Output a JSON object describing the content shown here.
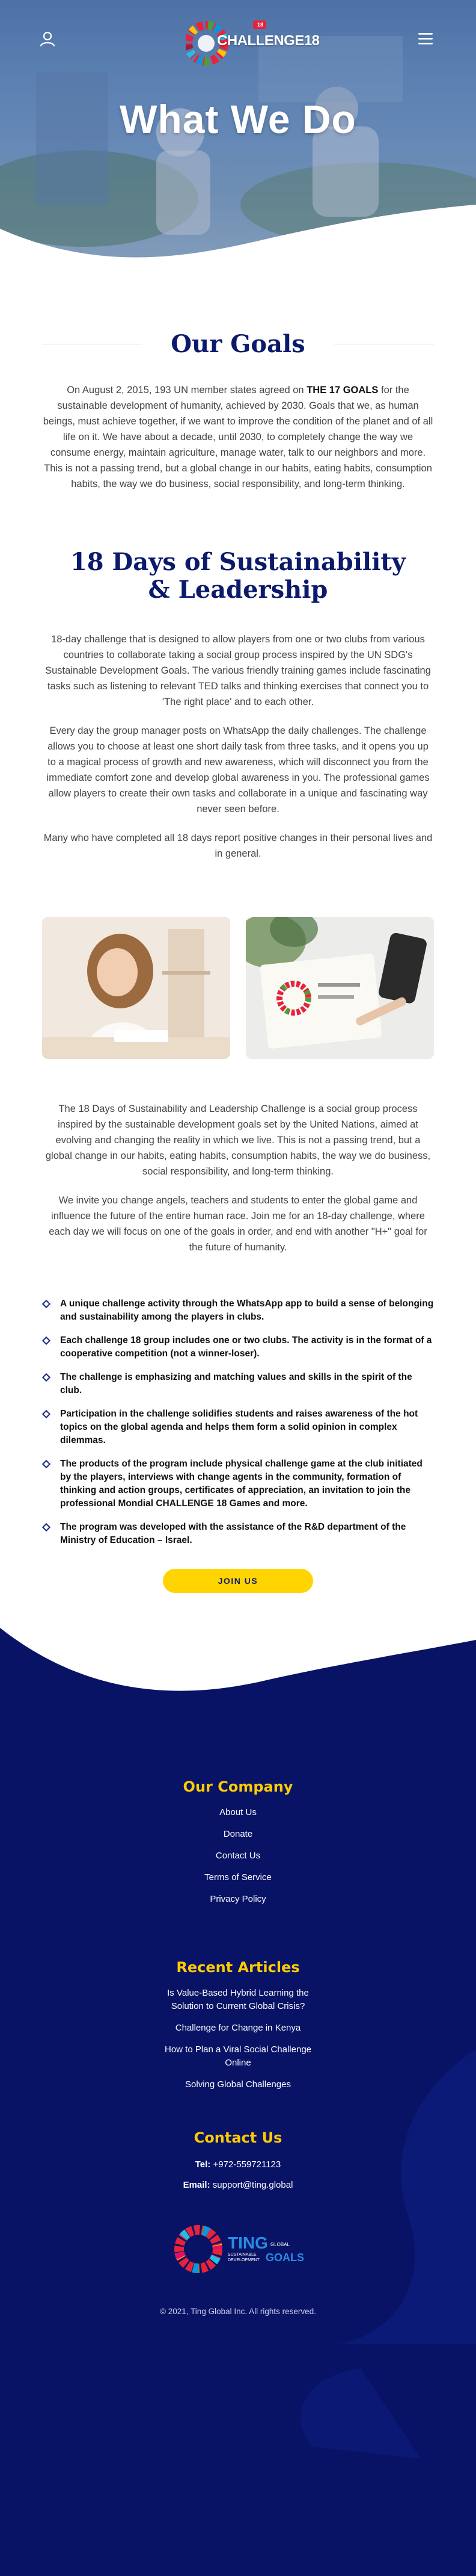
{
  "header": {
    "logo_text": "CHALLENGE18",
    "logo_badge": "18",
    "page_title": "What We Do"
  },
  "goals": {
    "heading": "Our Goals",
    "text_pre": "On August 2, 2015, 193 UN member states agreed on ",
    "text_bold": "THE 17 GOALS",
    "text_post": " for the sustainable development of humanity, achieved by 2030. Goals that we, as human beings, must achieve together, if we want to improve the condition of the planet and of all life on it. We have about a decade, until 2030, to completely change the way we consume energy, maintain agriculture, manage water, talk to our neighbors and more. This is not a passing trend, but a global change in our habits, eating habits, consumption habits, the way we do business, social responsibility, and long-term thinking."
  },
  "days": {
    "heading_line1": "18 Days of Sustainability",
    "heading_line2": "& Leadership",
    "p1": "18-day challenge that is designed to allow players from one or two clubs from various countries to collaborate taking a social group process inspired by the UN SDG's Sustainable Development Goals. The various friendly training games include fascinating tasks such as listening to relevant TED talks and thinking exercises that connect you to 'The right place' and to each other.",
    "p2": "Every day the group manager posts on WhatsApp the daily challenges. The challenge allows you to choose at least one short daily task from three tasks, and it opens you up to a magical process of growth and new awareness, which will disconnect you from the immediate comfort zone and develop global awareness in you. The professional games allow players to create their own tasks and collaborate in a unique and fascinating way never seen before.",
    "p3": "Many who have completed all 18 days report positive changes in their personal lives and in general."
  },
  "about": {
    "p1": "The 18 Days of Sustainability and Leadership Challenge is a social group process inspired by the sustainable development goals set by the United Nations, aimed at evolving and changing the reality in which we live. This is not a passing trend, but a global change in our habits, eating habits, consumption habits, the way we do business, social responsibility, and long-term thinking.",
    "p2": "We invite you change angels, teachers and students to enter the global game and influence the future of the entire human race. Join me for an 18-day challenge, where each day we will focus on one of the goals in order, and end with another \"H+\" goal for the future of humanity."
  },
  "features": [
    "A unique challenge activity through the WhatsApp app to build a sense of belonging and sustainability among the players in clubs.",
    "Each challenge 18 group includes one or two clubs. The activity is in the format of a cooperative competition (not a winner-loser).",
    "The challenge is emphasizing and matching values and skills in the spirit of the club.",
    "Participation in the challenge solidifies students and raises awareness of the hot topics on the global agenda and helps them form a solid opinion in complex dilemmas.",
    "The products of the program include physical challenge game at the club initiated by the players, interviews with change agents in the community, formation of thinking and action groups, certificates of appreciation, an invitation to join the professional Mondial CHALLENGE 18 Games and more.",
    "The program was developed with the assistance of the R&D department of the Ministry of Education – Israel."
  ],
  "cta": {
    "join_label": "JOIN US"
  },
  "footer": {
    "company_heading": "Our Company",
    "company_links": [
      "About Us",
      "Donate",
      "Contact Us",
      "Terms of Service",
      "Privacy Policy"
    ],
    "articles_heading": "Recent Articles",
    "articles": [
      {
        "line1": "Is Value-Based Hybrid Learning the",
        "line2": "Solution to Current Global Crisis?"
      },
      {
        "line1": "Challenge for Change in Kenya",
        "line2": ""
      },
      {
        "line1": "How to Plan a Viral Social Challenge",
        "line2": "Online"
      },
      {
        "line1": "Solving Global Challenges",
        "line2": ""
      }
    ],
    "contact_heading": "Contact Us",
    "tel_label": "Tel:",
    "tel_value": "+972-559721123",
    "email_label": "Email:",
    "email_value": "support@ting.global",
    "logo_brand": "TING",
    "logo_small1": "GLOBAL",
    "logo_small2": "SUSTAINABLE",
    "logo_small3": "DEVELOPMENT",
    "logo_goals": "GOALS",
    "copyright": "© 2021, Ting Global Inc. All rights reserved."
  },
  "colors": {
    "navy": "#0b1a6b",
    "yellow": "#ffd400",
    "footer_bg": "#081366"
  }
}
